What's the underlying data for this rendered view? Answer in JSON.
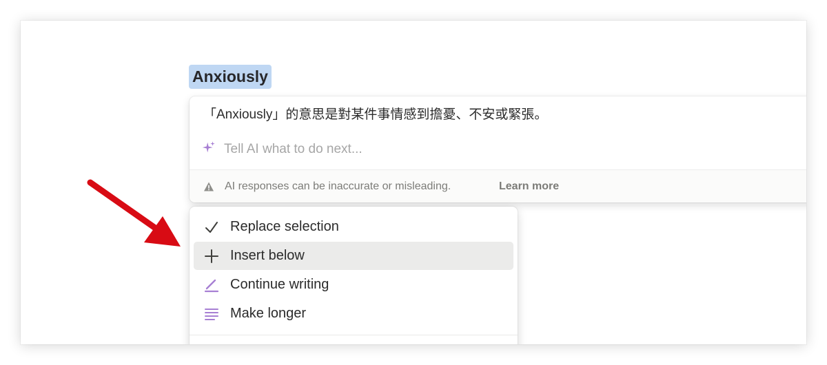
{
  "selection": {
    "text": "Anxiously"
  },
  "ai_panel": {
    "response_text": "「Anxiously」的意思是對某件事情感到擔憂、不安或緊張。",
    "input": {
      "placeholder": "Tell AI what to do next...",
      "value": "",
      "icon": "sparkle-icon"
    },
    "footer": {
      "icon": "warning-icon",
      "disclaimer": "AI responses can be inaccurate or misleading.",
      "learn_more": "Learn more"
    }
  },
  "menu": {
    "items": [
      {
        "label": "Replace selection",
        "icon": "checkmark-icon",
        "highlighted": false
      },
      {
        "label": "Insert below",
        "icon": "plus-icon",
        "highlighted": true
      },
      {
        "label": "Continue writing",
        "icon": "pen-icon",
        "highlighted": false
      },
      {
        "label": "Make longer",
        "icon": "lines-icon",
        "highlighted": false
      }
    ]
  },
  "annotation": {
    "icon": "red-arrow-icon",
    "color": "#d80b14"
  },
  "colors": {
    "selection_highlight": "#bfd7f3",
    "ai_accent": "#a77fd3",
    "menu_hover": "#ebebea"
  }
}
